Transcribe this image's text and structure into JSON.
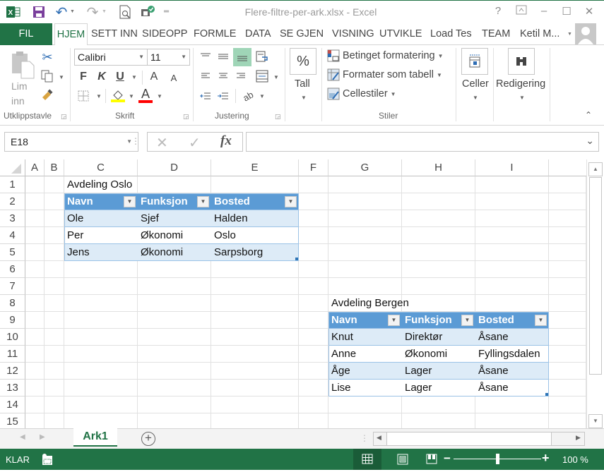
{
  "app": {
    "window_title": "Flere-filtre-per-ark.xlsx - Excel",
    "quick_access": [
      "excel-logo",
      "save",
      "undo",
      "redo",
      "print-preview",
      "sync"
    ],
    "window_controls": [
      "?",
      "ribbon-display",
      "minimize",
      "maximize",
      "close"
    ]
  },
  "tabs": {
    "file": "FIL",
    "items": [
      {
        "label": "HJEM",
        "active": true
      },
      {
        "label": "SETT INN"
      },
      {
        "label": "SIDEOPP"
      },
      {
        "label": "FORMLE"
      },
      {
        "label": "DATA"
      },
      {
        "label": "SE GJEN"
      },
      {
        "label": "VISNING"
      },
      {
        "label": "UTVIKLE"
      },
      {
        "label": "Load Tes"
      },
      {
        "label": "TEAM"
      }
    ],
    "user": "Ketil M..."
  },
  "ribbon": {
    "clipboard": {
      "paste_line1": "Lim",
      "paste_line2": "inn",
      "label": "Utklippstavle"
    },
    "font": {
      "name": "Calibri",
      "size": "11",
      "bold": "F",
      "italic": "K",
      "underline": "U",
      "grow": "A",
      "shrink": "A",
      "color_letter": "A",
      "label": "Skrift",
      "fill_color": "#ffff00",
      "font_color": "#ff0000"
    },
    "alignment": {
      "label": "Justering"
    },
    "number": {
      "symbol": "%",
      "label": "Tall"
    },
    "styles": {
      "conditional": "Betinget formatering",
      "as_table": "Formater som tabell",
      "cell_styles": "Cellestiler",
      "label": "Stiler"
    },
    "cells": {
      "label": "Celler"
    },
    "editing": {
      "label": "Redigering"
    }
  },
  "formula_bar": {
    "name_box": "E18",
    "fx": "fx",
    "value": ""
  },
  "grid": {
    "columns": [
      "A",
      "B",
      "C",
      "D",
      "E",
      "F",
      "G",
      "H",
      "I"
    ],
    "rows": [
      "1",
      "2",
      "3",
      "4",
      "5",
      "6",
      "7",
      "8",
      "9",
      "10",
      "11",
      "12",
      "13",
      "14",
      "15"
    ]
  },
  "tables": [
    {
      "title": "Avdeling Oslo",
      "headers": [
        "Navn",
        "Funksjon",
        "Bosted"
      ],
      "rows": [
        [
          "Ole",
          "Sjef",
          "Halden"
        ],
        [
          "Per",
          "Økonomi",
          "Oslo"
        ],
        [
          "Jens",
          "Økonomi",
          "Sarpsborg"
        ]
      ]
    },
    {
      "title": "Avdeling Bergen",
      "headers": [
        "Navn",
        "Funksjon",
        "Bosted"
      ],
      "rows": [
        [
          "Knut",
          "Direktør",
          "Åsane"
        ],
        [
          "Anne",
          "Økonomi",
          "Fyllingsdalen"
        ],
        [
          "Åge",
          "Lager",
          "Åsane"
        ],
        [
          "Lise",
          "Lager",
          "Åsane"
        ]
      ]
    }
  ],
  "sheets": [
    {
      "label": "Ark1",
      "active": true
    }
  ],
  "status": {
    "ready": "KLAR",
    "zoom": "100 %",
    "zoom_percent": 100
  },
  "colors": {
    "excel_green": "#217346",
    "table_header": "#5b9bd5",
    "table_band": "#ddebf7"
  }
}
